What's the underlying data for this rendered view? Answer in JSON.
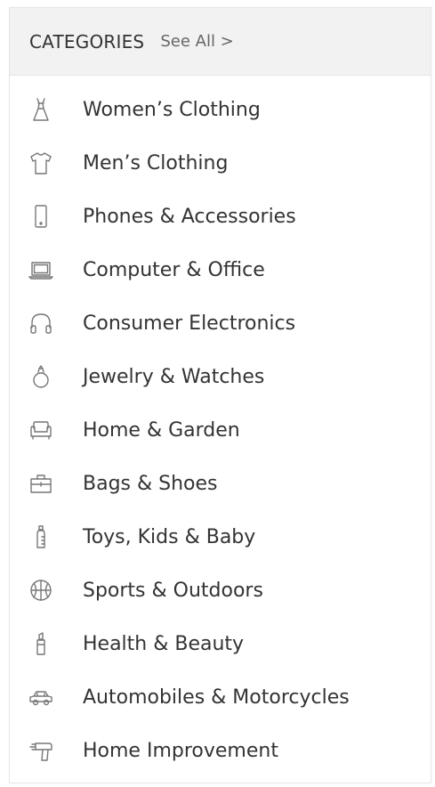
{
  "header": {
    "title": "CATEGORIES",
    "see_all": "See All >"
  },
  "categories": [
    {
      "label": "Women’s Clothing",
      "icon": "dress-icon"
    },
    {
      "label": "Men’s Clothing",
      "icon": "tshirt-icon"
    },
    {
      "label": "Phones & Accessories",
      "icon": "phone-icon"
    },
    {
      "label": "Computer & Office",
      "icon": "laptop-icon"
    },
    {
      "label": "Consumer Electronics",
      "icon": "headphones-icon"
    },
    {
      "label": "Jewelry & Watches",
      "icon": "ring-icon"
    },
    {
      "label": "Home & Garden",
      "icon": "sofa-icon"
    },
    {
      "label": "Bags & Shoes",
      "icon": "bag-icon"
    },
    {
      "label": "Toys, Kids & Baby",
      "icon": "baby-bottle-icon"
    },
    {
      "label": "Sports & Outdoors",
      "icon": "ball-icon"
    },
    {
      "label": "Health & Beauty",
      "icon": "lipstick-icon"
    },
    {
      "label": "Automobiles & Motorcycles",
      "icon": "car-icon"
    },
    {
      "label": "Home Improvement",
      "icon": "drill-icon"
    }
  ],
  "colors": {
    "header_bg": "#f2f2f2",
    "text": "#333333",
    "icon_stroke": "#777777",
    "link": "#666666"
  }
}
